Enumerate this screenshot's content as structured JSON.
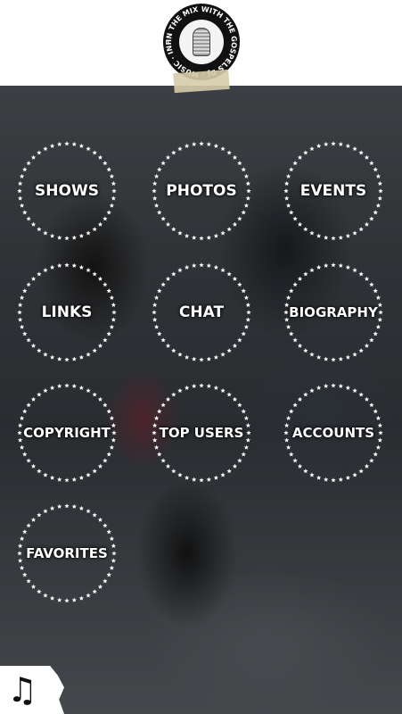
{
  "header": {
    "logo_text": "IN THE MIX WITH THE GOSPELS DJ · MUSIC · INFORMATION"
  },
  "menu": [
    {
      "key": "shows",
      "label": "SHOWS"
    },
    {
      "key": "photos",
      "label": "PHOTOS"
    },
    {
      "key": "events",
      "label": "EVENTS"
    },
    {
      "key": "links",
      "label": "LINKS"
    },
    {
      "key": "chat",
      "label": "CHAT"
    },
    {
      "key": "biography",
      "label": "BIOGRAPHY"
    },
    {
      "key": "copyright",
      "label": "COPYRIGHT"
    },
    {
      "key": "top_users",
      "label": "TOP USERS"
    },
    {
      "key": "accounts",
      "label": "ACCOUNTS"
    },
    {
      "key": "favorites",
      "label": "FAVORITES"
    }
  ],
  "footer": {
    "music_icon": "music-note-icon"
  }
}
